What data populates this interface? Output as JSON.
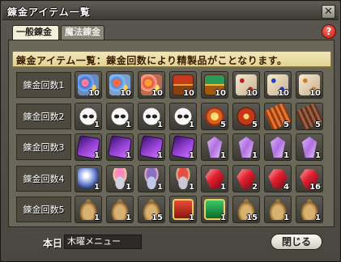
{
  "window": {
    "title": "錬金アイテム一覧",
    "close_glyph": "✕"
  },
  "tabs": [
    {
      "label": "一般錬金",
      "active": true
    },
    {
      "label": "魔法錬金",
      "active": false
    }
  ],
  "help_glyph": "?",
  "header": {
    "text": "錬金アイテム一覧：錬金回数により精製品がことなります。"
  },
  "rows": [
    {
      "label": "錬金回数1",
      "items": [
        {
          "icon": "flower-item-icon",
          "style": "ic-flower",
          "qty": "10"
        },
        {
          "icon": "flower-item-icon",
          "style": "ic-flower2",
          "qty": "10"
        },
        {
          "icon": "flower-item-icon",
          "style": "ic-flower3",
          "qty": "10"
        },
        {
          "icon": "treasure-chest-icon",
          "style": "ic-chest1",
          "qty": "10"
        },
        {
          "icon": "treasure-chest-icon",
          "style": "ic-chest2",
          "qty": "10"
        },
        {
          "icon": "dice-icon",
          "style": "ic-dice1",
          "qty": "10"
        },
        {
          "icon": "dice-icon",
          "style": "ic-dice2",
          "qty": "10"
        },
        {
          "icon": "dice-icon",
          "style": "ic-dice3",
          "qty": "10"
        }
      ]
    },
    {
      "label": "錬金回数2",
      "items": [
        {
          "icon": "mask-icon",
          "style": "ic-mask",
          "qty": "1"
        },
        {
          "icon": "mask-icon",
          "style": "ic-mask",
          "qty": "1"
        },
        {
          "icon": "mask-icon",
          "style": "ic-mask",
          "qty": "1"
        },
        {
          "icon": "mask-icon",
          "style": "ic-mask",
          "qty": "1"
        },
        {
          "icon": "medal-icon",
          "style": "ic-medal",
          "qty": "5"
        },
        {
          "icon": "pie-icon",
          "style": "ic-pie",
          "qty": "5"
        },
        {
          "icon": "roll-icon",
          "style": "ic-roll",
          "qty": "5"
        },
        {
          "icon": "roll-icon",
          "style": "ic-roll2",
          "qty": "5"
        }
      ]
    },
    {
      "label": "錬金回数3",
      "items": [
        {
          "icon": "purple-card-icon",
          "style": "ic-purple-card",
          "qty": "1"
        },
        {
          "icon": "purple-card-icon",
          "style": "ic-purple-card",
          "qty": "1"
        },
        {
          "icon": "purple-card-icon",
          "style": "ic-purple-card",
          "qty": "1"
        },
        {
          "icon": "purple-card-icon",
          "style": "ic-purple-card",
          "qty": "1"
        },
        {
          "icon": "crystal-icon",
          "style": "ic-crystal",
          "qty": "1"
        },
        {
          "icon": "crystal-icon",
          "style": "ic-crystal",
          "qty": "1"
        },
        {
          "icon": "crystal-icon",
          "style": "ic-crystal",
          "qty": "1"
        },
        {
          "icon": "crystal-icon",
          "style": "ic-crystal",
          "qty": "1"
        }
      ]
    },
    {
      "label": "錬金回数4",
      "items": [
        {
          "icon": "orb-icon",
          "style": "ic-orb",
          "qty": "1"
        },
        {
          "icon": "veil-icon",
          "style": "ic-veil1",
          "qty": "1"
        },
        {
          "icon": "veil-icon",
          "style": "ic-veil2",
          "qty": "1"
        },
        {
          "icon": "veil-icon",
          "style": "ic-veil3",
          "qty": "1"
        },
        {
          "icon": "ruby-icon",
          "style": "ic-ruby",
          "qty": "1"
        },
        {
          "icon": "ruby-icon",
          "style": "ic-ruby",
          "qty": "2"
        },
        {
          "icon": "ruby-icon",
          "style": "ic-ruby",
          "qty": "4"
        },
        {
          "icon": "ruby-icon",
          "style": "ic-ruby",
          "qty": "16"
        }
      ]
    },
    {
      "label": "錬金回数5",
      "items": [
        {
          "icon": "bag-icon",
          "style": "ic-bag",
          "qty": "1"
        },
        {
          "icon": "bag-icon",
          "style": "ic-bag",
          "qty": "1"
        },
        {
          "icon": "bag-icon",
          "style": "ic-bag",
          "qty": "15"
        },
        {
          "icon": "gift-box-icon",
          "style": "ic-box-red",
          "qty": "1"
        },
        {
          "icon": "gift-box-icon",
          "style": "ic-box-green",
          "qty": "1"
        },
        {
          "icon": "bag-icon",
          "style": "ic-bag",
          "qty": "15"
        },
        {
          "icon": "bag-icon",
          "style": "ic-bag",
          "qty": "1"
        },
        {
          "icon": "bag-icon",
          "style": "ic-bag",
          "qty": "1"
        }
      ]
    }
  ],
  "footer": {
    "today_label": "本日",
    "today_value": "木曜メニュー",
    "close_label": "閉じる"
  }
}
